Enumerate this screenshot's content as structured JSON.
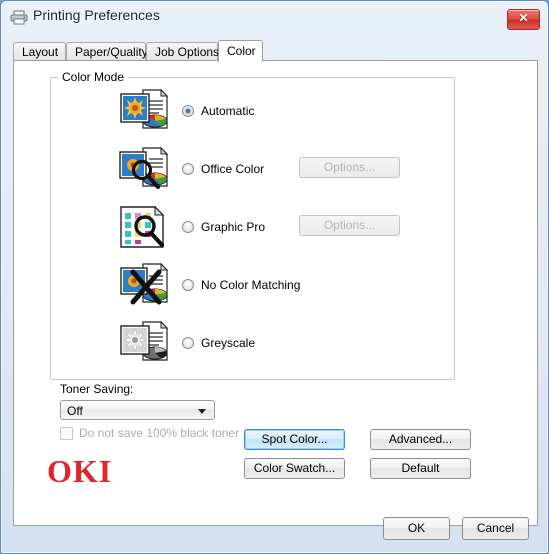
{
  "window": {
    "title": "Printing Preferences",
    "printer_icon": "printer-icon",
    "close_label": "✕"
  },
  "tabs": [
    {
      "label": "Layout",
      "active": false
    },
    {
      "label": "Paper/Quality",
      "active": false
    },
    {
      "label": "Job Options",
      "active": false
    },
    {
      "label": "Color",
      "active": true
    }
  ],
  "color_mode": {
    "group_label": "Color Mode",
    "options": [
      {
        "label": "Automatic",
        "selected": true,
        "icon": "color-document-icon",
        "has_options_button": false
      },
      {
        "label": "Office Color",
        "selected": false,
        "icon": "office-color-magnifier-icon",
        "has_options_button": true,
        "options_label": "Options...",
        "options_enabled": false
      },
      {
        "label": "Graphic Pro",
        "selected": false,
        "icon": "graphic-pro-swatch-magnifier-icon",
        "has_options_button": true,
        "options_label": "Options...",
        "options_enabled": false
      },
      {
        "label": "No Color Matching",
        "selected": false,
        "icon": "no-color-matching-cross-icon",
        "has_options_button": false
      },
      {
        "label": "Greyscale",
        "selected": false,
        "icon": "greyscale-document-icon",
        "has_options_button": false
      }
    ]
  },
  "toner_saving": {
    "label": "Toner Saving:",
    "selected_value": "Off",
    "options": [
      "Off"
    ],
    "black_toner_checkbox": {
      "label": "Do not save 100% black toner",
      "checked": false,
      "enabled": false
    }
  },
  "actions": {
    "spot_color": "Spot Color...",
    "color_swatch": "Color Swatch...",
    "advanced": "Advanced...",
    "default": "Default"
  },
  "branding": {
    "logo_text": "OKI",
    "logo_color": "#e1242a"
  },
  "footer": {
    "ok": "OK",
    "cancel": "Cancel"
  }
}
